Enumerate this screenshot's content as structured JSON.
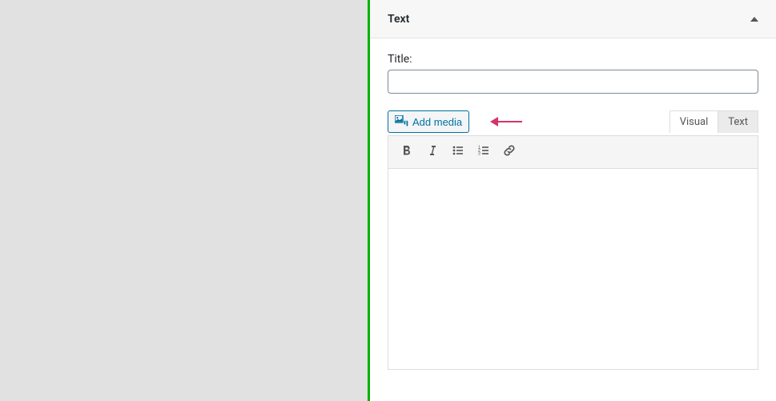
{
  "widget": {
    "header_title": "Text"
  },
  "title_field": {
    "label": "Title:",
    "value": "",
    "placeholder": ""
  },
  "add_media": {
    "label": "Add media"
  },
  "tabs": {
    "visual": "Visual",
    "text": "Text"
  },
  "editor": {
    "content": ""
  }
}
